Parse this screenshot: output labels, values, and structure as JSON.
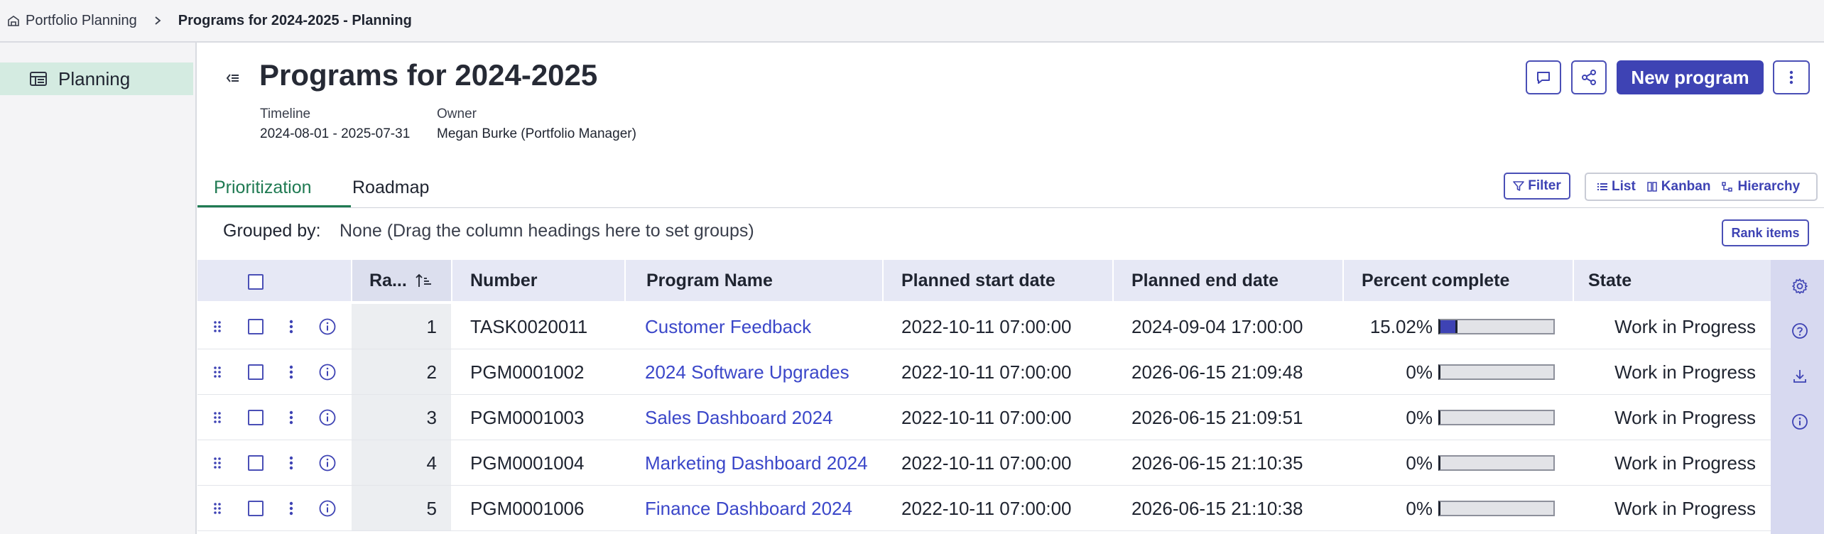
{
  "breadcrumb": {
    "parent": "Portfolio Planning",
    "current": "Programs for 2024-2025 - Planning"
  },
  "sidebar": {
    "items": [
      {
        "label": "Planning",
        "icon": "table-icon"
      }
    ]
  },
  "header": {
    "title": "Programs for 2024-2025",
    "timeline_label": "Timeline",
    "timeline_value": "2024-08-01 - 2025-07-31",
    "owner_label": "Owner",
    "owner_value": "Megan Burke (Portfolio Manager)",
    "new_program_label": "New program"
  },
  "tabs": [
    {
      "label": "Prioritization",
      "active": true
    },
    {
      "label": "Roadmap",
      "active": false
    }
  ],
  "toolbar": {
    "filter_label": "Filter",
    "views": [
      "List",
      "Kanban",
      "Hierarchy"
    ],
    "rank_items_label": "Rank items"
  },
  "grouping": {
    "label": "Grouped by:",
    "value": "None (Drag the column headings here to set groups)"
  },
  "table": {
    "columns": {
      "rank": "Ra...",
      "number": "Number",
      "name": "Program Name",
      "start": "Planned start date",
      "end": "Planned end date",
      "percent": "Percent complete",
      "state": "State"
    },
    "rows": [
      {
        "rank": "1",
        "number": "TASK0020011",
        "name": "Customer Feedback",
        "start": "2022-10-11 07:00:00",
        "end": "2024-09-04 17:00:00",
        "percent": "15.02%",
        "percent_value": 0.1502,
        "state": "Work in Progress"
      },
      {
        "rank": "2",
        "number": "PGM0001002",
        "name": "2024 Software Upgrades",
        "start": "2022-10-11 07:00:00",
        "end": "2026-06-15 21:09:48",
        "percent": "0%",
        "percent_value": 0,
        "state": "Work in Progress"
      },
      {
        "rank": "3",
        "number": "PGM0001003",
        "name": "Sales Dashboard 2024",
        "start": "2022-10-11 07:00:00",
        "end": "2026-06-15 21:09:51",
        "percent": "0%",
        "percent_value": 0,
        "state": "Work in Progress"
      },
      {
        "rank": "4",
        "number": "PGM0001004",
        "name": "Marketing Dashboard 2024",
        "start": "2022-10-11 07:00:00",
        "end": "2026-06-15 21:10:35",
        "percent": "0%",
        "percent_value": 0,
        "state": "Work in Progress"
      },
      {
        "rank": "5",
        "number": "PGM0001006",
        "name": "Finance Dashboard 2024",
        "start": "2022-10-11 07:00:00",
        "end": "2026-06-15 21:10:38",
        "percent": "0%",
        "percent_value": 0,
        "state": "Work in Progress"
      }
    ]
  },
  "colors": {
    "accent": "#3e43b4",
    "link": "#3b47c9",
    "tab_active": "#1f7a52",
    "sidebar_selected": "#d4ebe1",
    "header_bg": "#e6e8f5"
  }
}
